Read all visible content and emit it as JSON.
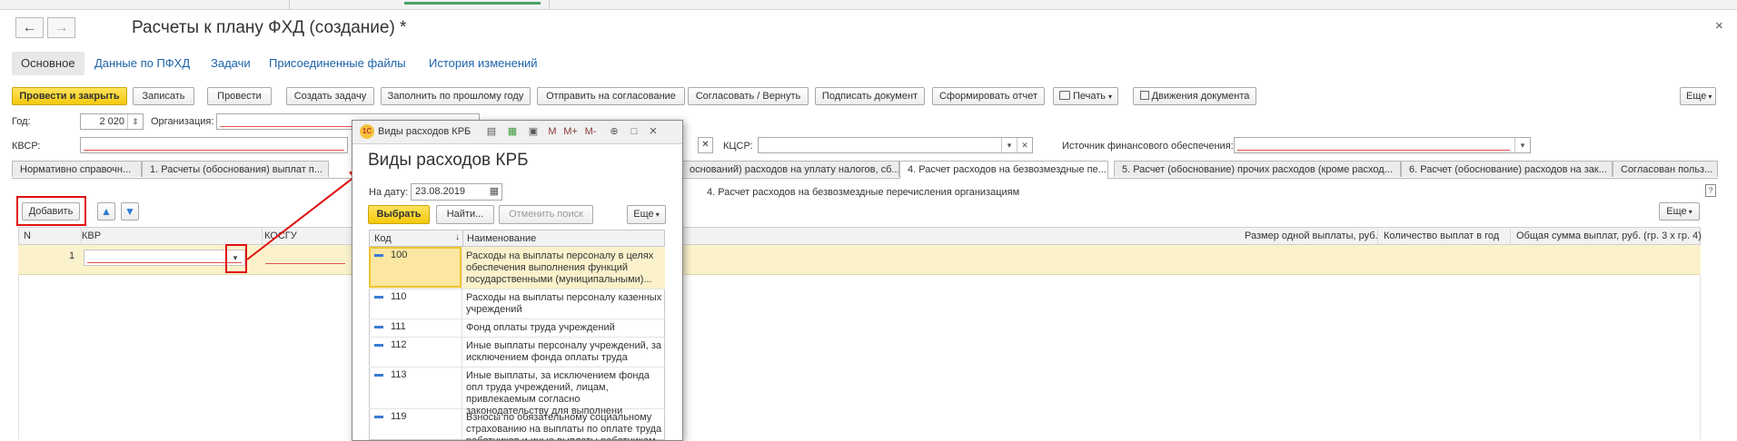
{
  "window": {
    "title": "Расчеты к плану ФХД (создание) *",
    "close_icon": "×",
    "back_icon": "←",
    "forward_icon": "→"
  },
  "form_tabs": [
    "Основное",
    "Данные по ПФХД",
    "Задачи",
    "Присоединенные файлы",
    "История изменений"
  ],
  "toolbar": {
    "post_close": "Провести и закрыть",
    "write": "Записать",
    "post": "Провести",
    "create_task": "Создать задачу",
    "fill_prev": "Заполнить по прошлому году",
    "send_approval": "Отправить на согласование",
    "approve_return": "Согласовать / Вернуть",
    "sign": "Подписать документ",
    "report": "Сформировать отчет",
    "print": "Печать",
    "movements": "Движения документа",
    "more": "Еще"
  },
  "fields": {
    "year_label": "Год:",
    "year_value": "2 020",
    "org_label": "Организация:",
    "kvsr_label": "КВСР:",
    "kcsr_label": "КЦСР:",
    "source_label": "Источник финансового обеспечения:"
  },
  "doc_tabs": [
    "Нормативно справочн...",
    "1. Расчеты (обоснования) выплат п...",
    "оснований) расходов на уплату налогов, сб...",
    "4. Расчет расходов на безвозмездные пе...",
    "5. Расчет (обоснование) прочих расходов (кроме расход...",
    "6. Расчет (обоснование) расходов на зак...",
    "Согласован польз..."
  ],
  "section": {
    "add": "Добавить",
    "heading": "4. Расчет расходов на безвозмездные перечисления организациям",
    "more": "Еще"
  },
  "table": {
    "headers": {
      "n": "N",
      "kvr": "КВР",
      "kosgu": "КОСГУ",
      "amount_one": "Размер одной выплаты, руб.",
      "count": "Количество выплат в год",
      "total": "Общая сумма выплат, руб. (гр. 3 х гр. 4)"
    },
    "row": {
      "n": "1"
    }
  },
  "dialog": {
    "title_bar": "Виды расходов КРБ",
    "heading": "Виды расходов КРБ",
    "date_label": "На дату:",
    "date_value": "23.08.2019",
    "choose": "Выбрать",
    "find": "Найти...",
    "cancel_search": "Отменить поиск",
    "more": "Еще",
    "col_code": "Код",
    "col_name": "Наименование",
    "titlebar_letters": [
      "М",
      "М+",
      "М-"
    ],
    "rows": [
      {
        "code": "100",
        "name": "Расходы на выплаты персоналу в целях обеспечения выполнения функций государственными (муниципальными)..."
      },
      {
        "code": "110",
        "name": "Расходы на выплаты персоналу казенных учреждений"
      },
      {
        "code": "111",
        "name": "Фонд оплаты труда учреждений"
      },
      {
        "code": "112",
        "name": "Иные выплаты персоналу учреждений, за исключением фонда оплаты труда"
      },
      {
        "code": "113",
        "name": "Иные выплаты, за исключением фонда опл труда учреждений, лицам, привлекаемым согласно законодательству для выполнени"
      },
      {
        "code": "119",
        "name": "Взносы по обязательному социальному страхованию на выплаты по оплате труда работников и иные выплаты работникам"
      }
    ]
  },
  "colors": {
    "accent_yellow": "#f4c90c",
    "link_blue": "#1d63a8",
    "highlight_red": "#e01010",
    "selected_row": "#fbf2cc"
  }
}
